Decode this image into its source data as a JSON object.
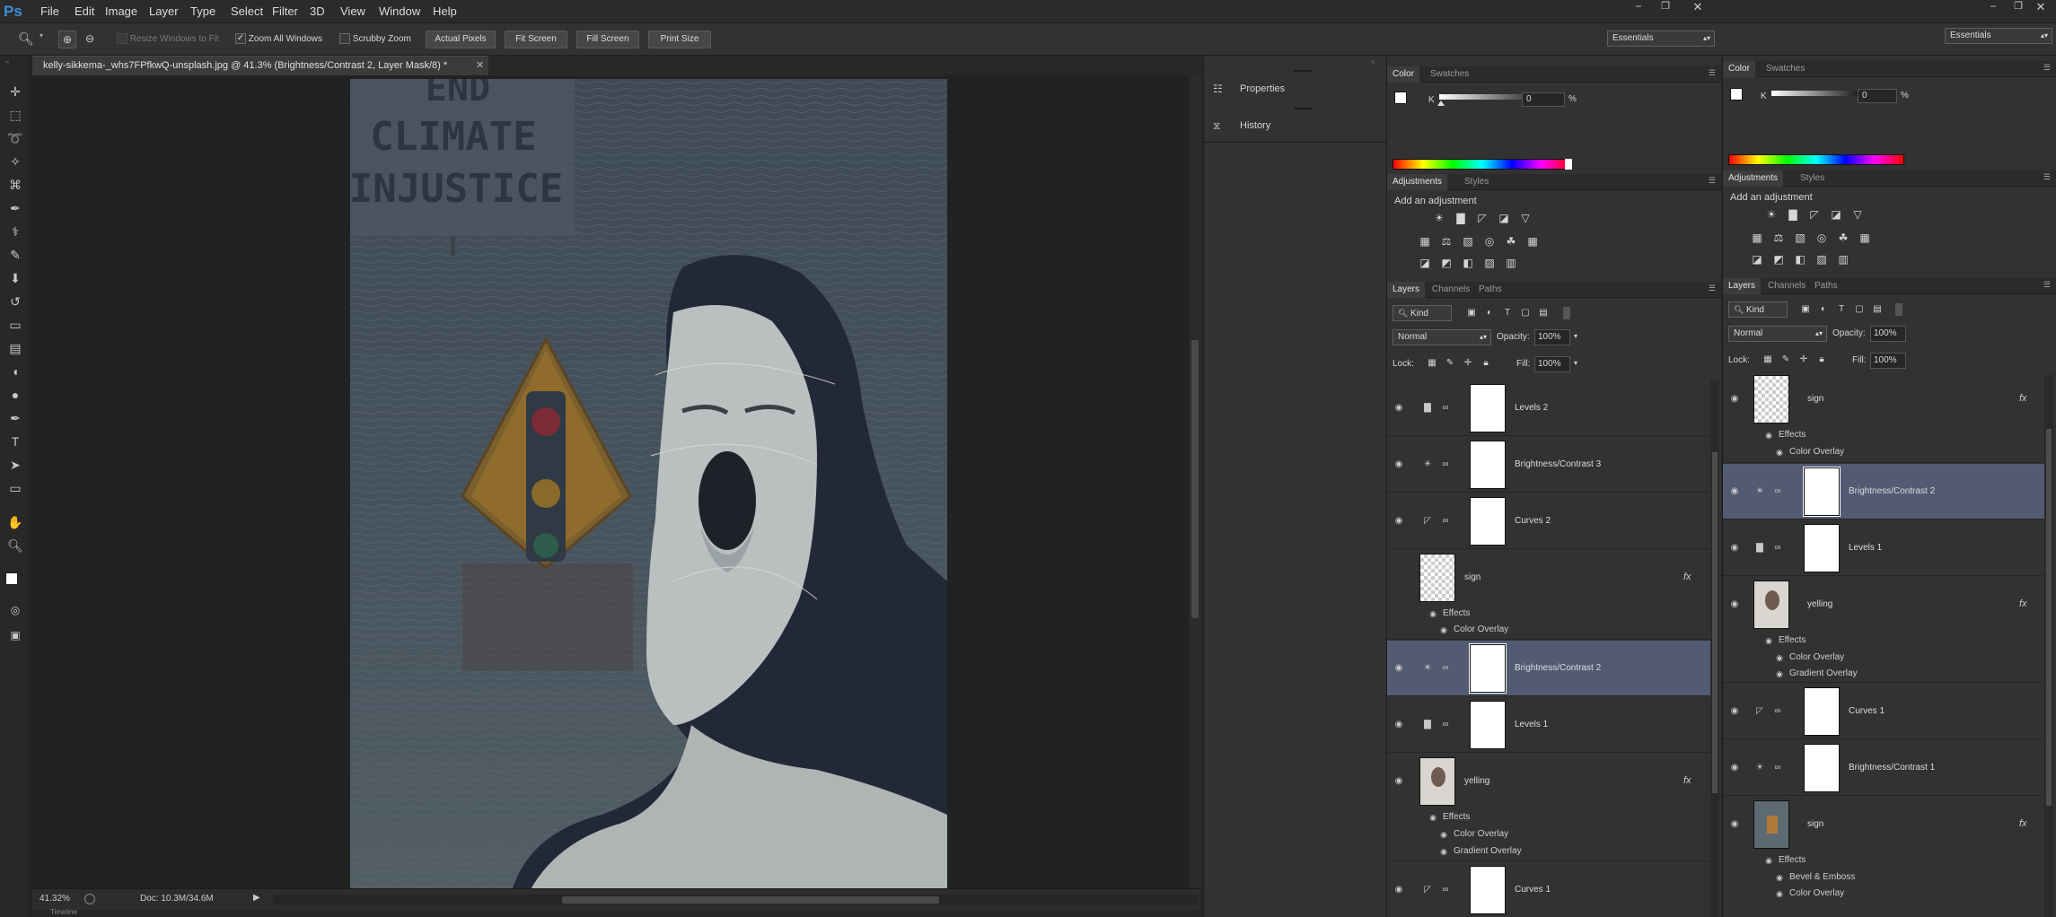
{
  "app": {
    "logo": "Ps",
    "workspace": "Essentials",
    "workspace2": "Essentials"
  },
  "menu": [
    "File",
    "Edit",
    "Image",
    "Layer",
    "Type",
    "Select",
    "Filter",
    "3D",
    "View",
    "Window",
    "Help"
  ],
  "options": {
    "resize_windows": "Resize Windows to Fit",
    "zoom_all": "Zoom All Windows",
    "scrubby": "Scrubby Zoom",
    "actual_pixels": "Actual Pixels",
    "fit_screen": "Fit Screen",
    "fill_screen": "Fill Screen",
    "print_size": "Print Size"
  },
  "document": {
    "tab_title": "kelly-sikkema-_whs7FPfkwQ-unsplash.jpg @ 41.3% (Brightness/Contrast 2, Layer Mask/8) *",
    "zoom": "41.32%",
    "doc_size": "Doc: 10.3M/34.6M",
    "timeline": "Timeline",
    "sign_lines": [
      "END",
      "CLIMATE",
      "INJUSTICE"
    ]
  },
  "mid_panel": {
    "properties": "Properties",
    "history": "History"
  },
  "panel1": {
    "color_tab": "Color",
    "swatches_tab": "Swatches",
    "k_label": "K",
    "k_value": "0",
    "k_unit": "%",
    "adjustments_tab": "Adjustments",
    "styles_tab": "Styles",
    "add_adjustment": "Add an adjustment",
    "layers_tab": "Layers",
    "channels_tab": "Channels",
    "paths_tab": "Paths",
    "kind": "Kind",
    "blend": "Normal",
    "opacity_label": "Opacity:",
    "opacity": "100%",
    "lock_label": "Lock:",
    "fill_label": "Fill:",
    "fill": "100%",
    "layers": [
      {
        "name": "Levels 2"
      },
      {
        "name": "Brightness/Contrast 3"
      },
      {
        "name": "Curves 2"
      },
      {
        "name": "sign",
        "effects": "Effects",
        "subs": [
          "Color Overlay"
        ]
      },
      {
        "name": "Brightness/Contrast 2"
      },
      {
        "name": "Levels 1"
      },
      {
        "name": "yelling",
        "effects": "Effects",
        "subs": [
          "Color Overlay",
          "Gradient Overlay"
        ]
      },
      {
        "name": "Curves 1"
      }
    ]
  },
  "panel2": {
    "color_tab": "Color",
    "swatches_tab": "Swatches",
    "k_label": "K",
    "k_value": "0",
    "k_unit": "%",
    "adjustments_tab": "Adjustments",
    "styles_tab": "Styles",
    "add_adjustment": "Add an adjustment",
    "layers_tab": "Layers",
    "channels_tab": "Channels",
    "paths_tab": "Paths",
    "kind": "Kind",
    "blend": "Normal",
    "opacity_label": "Opacity:",
    "opacity": "100%",
    "lock_label": "Lock:",
    "fill_label": "Fill:",
    "fill": "100%",
    "layers": [
      {
        "name": "sign",
        "effects": "Effects",
        "subs": [
          "Color Overlay"
        ]
      },
      {
        "name": "Brightness/Contrast 2"
      },
      {
        "name": "Levels 1"
      },
      {
        "name": "yelling",
        "effects": "Effects",
        "subs": [
          "Color Overlay",
          "Gradient Overlay"
        ]
      },
      {
        "name": "Curves 1"
      },
      {
        "name": "Brightness/Contrast 1"
      },
      {
        "name": "sign",
        "effects": "Effects",
        "subs": [
          "Bevel & Emboss",
          "Color Overlay"
        ]
      }
    ]
  },
  "fx": "fx",
  "colors": {
    "selected_row": "#525b72",
    "accent": "#3d8fd6"
  }
}
